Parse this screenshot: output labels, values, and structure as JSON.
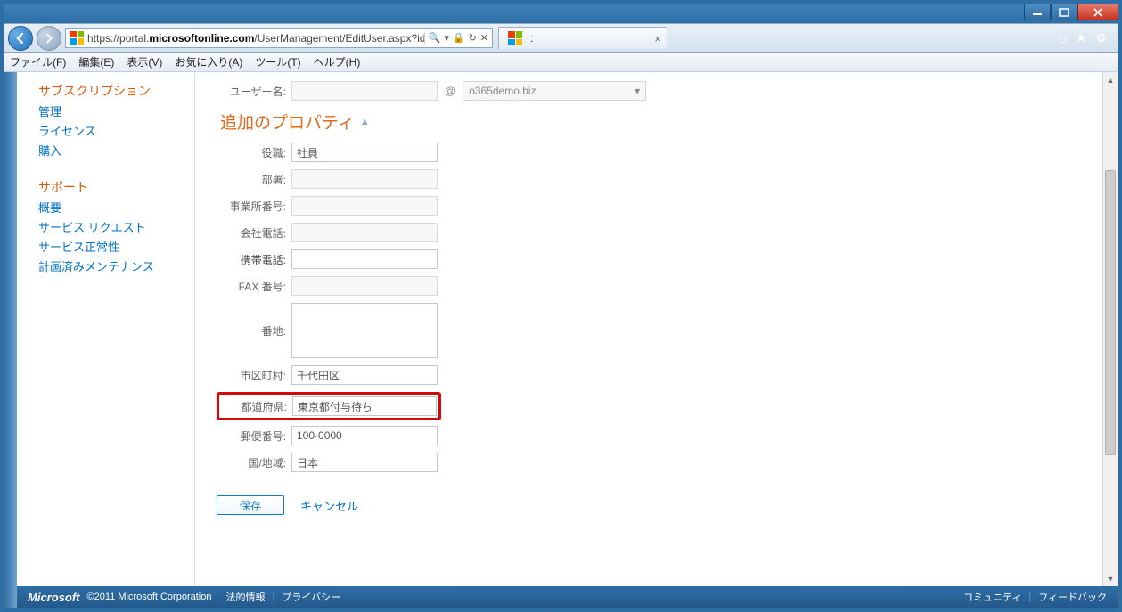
{
  "browser": {
    "url_pre": "https://portal.",
    "url_dom": "microsoftonline.com",
    "url_post": "/UserManagement/EditUser.aspx?id=a",
    "tab_title": ":",
    "menu": {
      "file": "ファイル(F)",
      "edit": "編集(E)",
      "view": "表示(V)",
      "fav": "お気に入り(A)",
      "tool": "ツール(T)",
      "help": "ヘルプ(H)"
    }
  },
  "sidebar": {
    "head1": "サブスクリプション",
    "links1": [
      "管理",
      "ライセンス",
      "購入"
    ],
    "head2": "サポート",
    "links2": [
      "概要",
      "サービス リクエスト",
      "サービス正常性",
      "計画済みメンテナンス"
    ]
  },
  "form": {
    "user_label": "ユーザー名:",
    "user_value": "",
    "at": "@",
    "domain": "o365demo.biz",
    "section": "追加のプロパティ",
    "fields": {
      "role": {
        "label": "役職:",
        "value": "社員"
      },
      "dept": {
        "label": "部署:",
        "value": ""
      },
      "office_no": {
        "label": "事業所番号:",
        "value": ""
      },
      "office_tel": {
        "label": "会社電話:",
        "value": ""
      },
      "mobile": {
        "label": "携帯電話:",
        "value": ""
      },
      "fax": {
        "label": "FAX 番号:",
        "value": ""
      },
      "street": {
        "label": "番地:",
        "value": ""
      },
      "city": {
        "label": "市区町村:",
        "value": "千代田区"
      },
      "state": {
        "label": "都道府県:",
        "value": "東京都付与待ち"
      },
      "zip": {
        "label": "郵便番号:",
        "value": "100-0000"
      },
      "country": {
        "label": "国/地域:",
        "value": "日本"
      }
    },
    "save": "保存",
    "cancel": "キャンセル"
  },
  "footer": {
    "brand": "Microsoft",
    "copyright": "©2011 Microsoft Corporation",
    "legal": "法的情報",
    "privacy": "プライバシー",
    "community": "コミュニティ",
    "feedback": "フィードバック"
  }
}
